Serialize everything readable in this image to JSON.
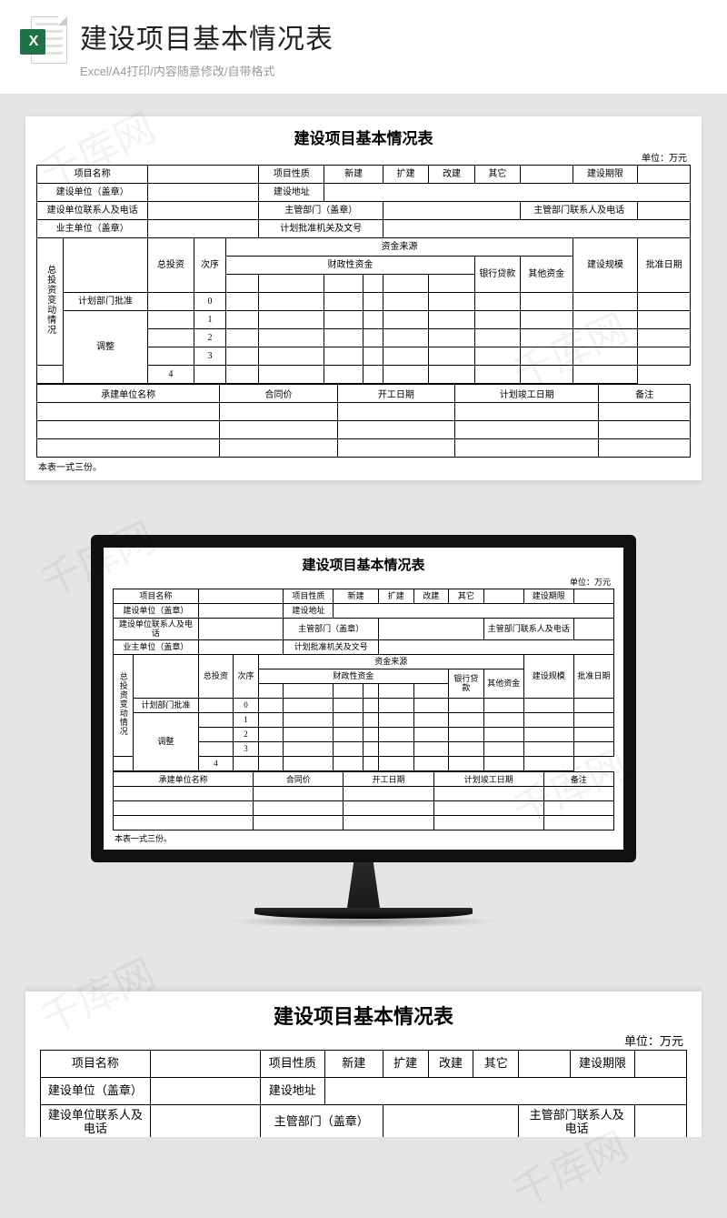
{
  "watermark_text": "千库网",
  "header": {
    "icon_letter": "X",
    "title": "建设项目基本情况表",
    "subtitle": "Excel/A4打印/内容随意修改/自带格式"
  },
  "sheet": {
    "title": "建设项目基本情况表",
    "unit": "单位：万元",
    "row1": {
      "project_name": "项目名称",
      "project_nature": "项目性质",
      "xinji": "新建",
      "kuojian": "扩建",
      "gaijian": "改建",
      "qita": "其它",
      "period": "建设期限"
    },
    "row2": {
      "build_unit": "建设单位（盖章）",
      "build_addr": "建设地址"
    },
    "row3": {
      "build_contact": "建设单位联系人及电话",
      "mgr_dept": "主管部门（盖章）",
      "mgr_contact": "主管部门联系人及电话"
    },
    "row4": {
      "owner_unit": "业主单位（盖章）",
      "plan_approval": "计划批准机关及文号"
    },
    "invest": {
      "side_label": "总投资变动情况",
      "total_invest": "总投资",
      "seq": "次序",
      "fund_source": "资金来源",
      "fiscal_fund": "财政性资金",
      "bank_loan": "银行贷款",
      "other_fund": "其他资金",
      "scale": "建设规模",
      "approve_date": "批准日期",
      "plan_dept_approve": "计划部门批准",
      "adjust": "调整",
      "seq_nums": [
        "0",
        "1",
        "2",
        "3",
        "4"
      ]
    },
    "sec2": {
      "contractor": "承建单位名称",
      "contract_price": "合同价",
      "start_date": "开工日期",
      "plan_finish": "计划竣工日期",
      "remark": "备注"
    },
    "footer": "本表一式三份。"
  }
}
